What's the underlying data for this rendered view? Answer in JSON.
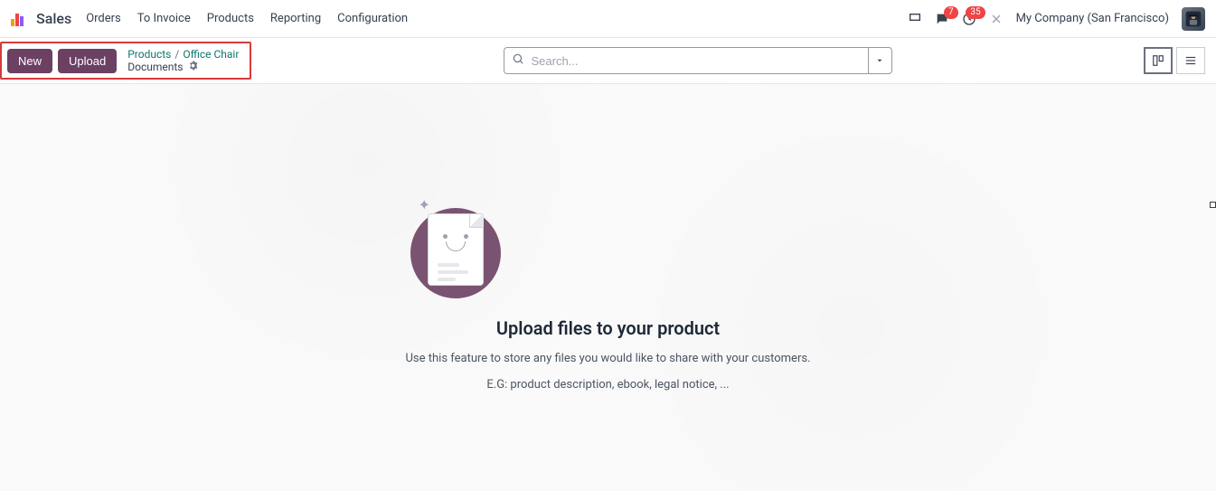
{
  "app": {
    "name": "Sales"
  },
  "menu": [
    "Orders",
    "To Invoice",
    "Products",
    "Reporting",
    "Configuration"
  ],
  "header": {
    "messages_badge": "7",
    "activities_badge": "35",
    "company": "My Company (San Francisco)"
  },
  "actions": {
    "new_label": "New",
    "upload_label": "Upload"
  },
  "breadcrumb": {
    "root": "Products",
    "item": "Office Chair",
    "current": "Documents"
  },
  "search": {
    "placeholder": "Search..."
  },
  "empty": {
    "title": "Upload files to your product",
    "line1": "Use this feature to store any files you would like to share with your customers.",
    "line2": "E.G: product description, ebook, legal notice, ..."
  }
}
